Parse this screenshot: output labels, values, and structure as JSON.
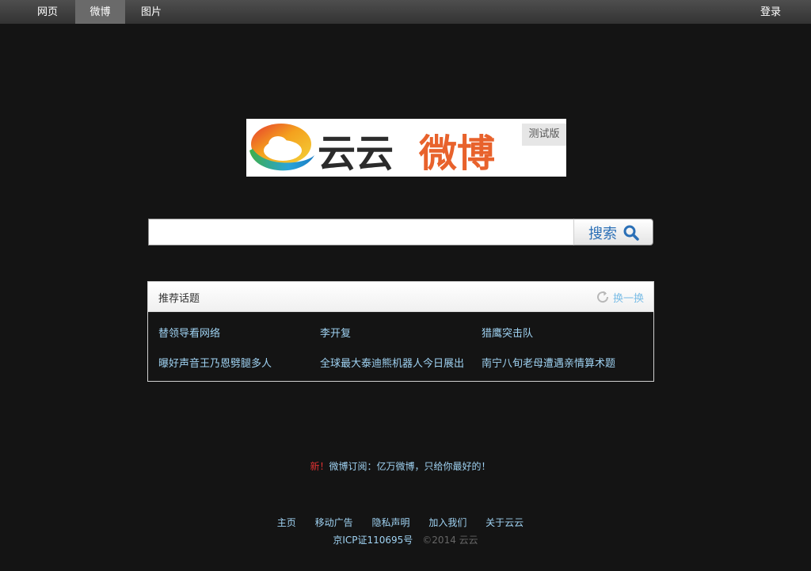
{
  "nav": {
    "tabs": [
      {
        "label": "网页",
        "active": false
      },
      {
        "label": "微博",
        "active": true
      },
      {
        "label": "图片",
        "active": false
      }
    ],
    "login": "登录"
  },
  "logo": {
    "text_part1": "云云",
    "text_part2": "微博",
    "badge": "测试版",
    "colors": {
      "dark": "#2b2b2b",
      "orange": "#e8622c"
    }
  },
  "search": {
    "value": "",
    "button_label": "搜索",
    "icon": "search-icon"
  },
  "topics": {
    "title": "推荐话题",
    "refresh_label": "换一换",
    "refresh_icon": "refresh-icon",
    "items": [
      "替领导看网络",
      "李开复",
      "猎鹰突击队",
      "曝好声音王乃恩劈腿多人",
      "全球最大泰迪熊机器人今日展出",
      "南宁八旬老母遭遇亲情算术题"
    ]
  },
  "notice": {
    "tag": "新",
    "separator": "！",
    "text": "微博订阅：亿万微博，只给你最好的！"
  },
  "footer": {
    "links": [
      "主页",
      "移动广告",
      "隐私声明",
      "加入我们",
      "关于云云"
    ],
    "icp": "京ICP证110695号",
    "copyright": "©2014 云云"
  }
}
